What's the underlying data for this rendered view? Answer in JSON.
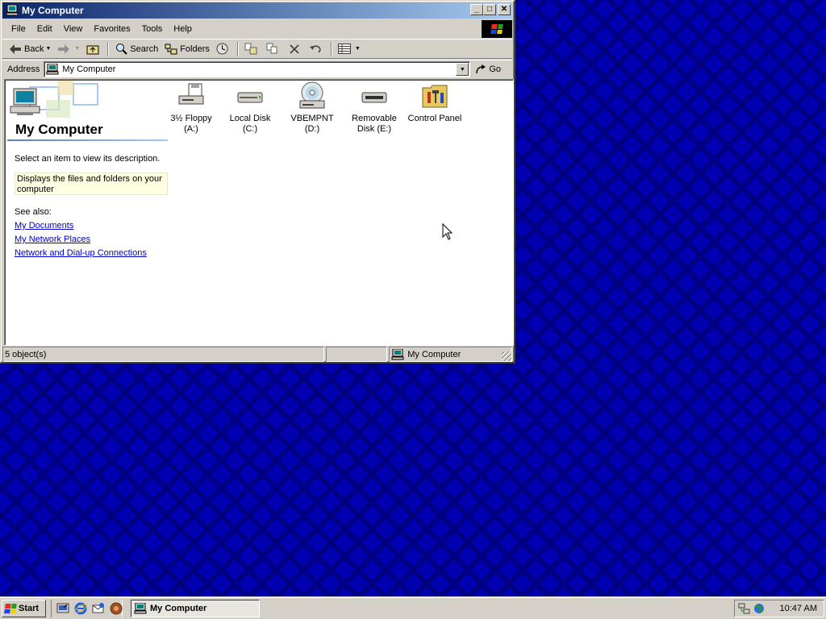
{
  "window": {
    "title": "My Computer",
    "controls": {
      "minimize": "_",
      "maximize": "□",
      "close": "✕"
    }
  },
  "menu": [
    "File",
    "Edit",
    "View",
    "Favorites",
    "Tools",
    "Help"
  ],
  "toolbar": {
    "back_label": "Back",
    "search_label": "Search",
    "folders_label": "Folders"
  },
  "address": {
    "label": "Address",
    "value": "My Computer",
    "go_label": "Go"
  },
  "webview": {
    "title": "My Computer",
    "hint": "Select an item to view its description.",
    "description": "Displays the files and folders on your computer",
    "see_also_label": "See also:",
    "links": [
      "My Documents",
      "My Network Places",
      "Network and Dial-up Connections"
    ]
  },
  "items": [
    {
      "label": "3½ Floppy (A:)",
      "icon": "floppy-drive-icon"
    },
    {
      "label": "Local Disk (C:)",
      "icon": "hard-disk-icon"
    },
    {
      "label": "VBEMPNT (D:)",
      "icon": "cd-drive-icon"
    },
    {
      "label": "Removable Disk (E:)",
      "icon": "removable-disk-icon"
    },
    {
      "label": "Control Panel",
      "icon": "control-panel-icon"
    }
  ],
  "status": {
    "objects": "5 object(s)",
    "zone": "My Computer"
  },
  "taskbar": {
    "start_label": "Start",
    "task_label": "My Computer",
    "clock": "10:47 AM"
  },
  "colors": {
    "title_gradient_start": "#0a246a",
    "title_gradient_end": "#a6caf0",
    "face": "#d4d0c8",
    "desktop": "#0000b0",
    "link": "#0000cc"
  }
}
